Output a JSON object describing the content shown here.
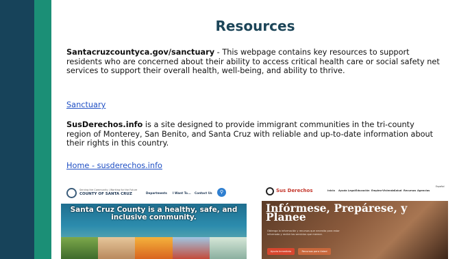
{
  "slide": {
    "title": "Resources",
    "para1_bold": "Santacruzcountyca.gov/sanctuary",
    "para1_rest": " - This webpage contains key resources to support residents who are concerned about their ability to access critical health care or social safety net services to support their overall health, well-being, and ability to thrive.",
    "link1": "Sanctuary",
    "para2_bold": "SusDerechos.info",
    "para2_rest": " is a site designed to provide immigrant communities in the tri-county region of Monterey, San Benito, and Santa Cruz with reliable and up-to-date information about their rights in this country.",
    "link2": "Home - susderechos.info"
  },
  "thumb_county": {
    "tagline": "Serving the Community | Working for the Future",
    "name": "COUNTY OF SANTA CRUZ",
    "nav": [
      "Departments",
      "I Want To...",
      "Contact Us"
    ],
    "hero_text": "Santa Cruz County is a healthy, safe, and inclusive community.",
    "search_icon": "search-icon"
  },
  "thumb_derechos": {
    "brand": "Sus Derechos",
    "nav": [
      "Inicio",
      "Ayuda Legal",
      "Educación",
      "Empleo-Vivienda",
      "Salud",
      "Recursos",
      "Agencias"
    ],
    "lang": "Español",
    "heading": "Infórmese, Prepárese, y Planee",
    "subtext": "Obtenga la información y recursos que necesita para estar informado y recibir los servicios que merece.",
    "buttons": [
      "Ayuda Inmediata",
      "Recursos para Usted"
    ]
  },
  "colors": {
    "sidebar_dark": "#17435a",
    "sidebar_teal": "#1b8f76",
    "title": "#1c4558",
    "link": "#1f4fc4"
  }
}
